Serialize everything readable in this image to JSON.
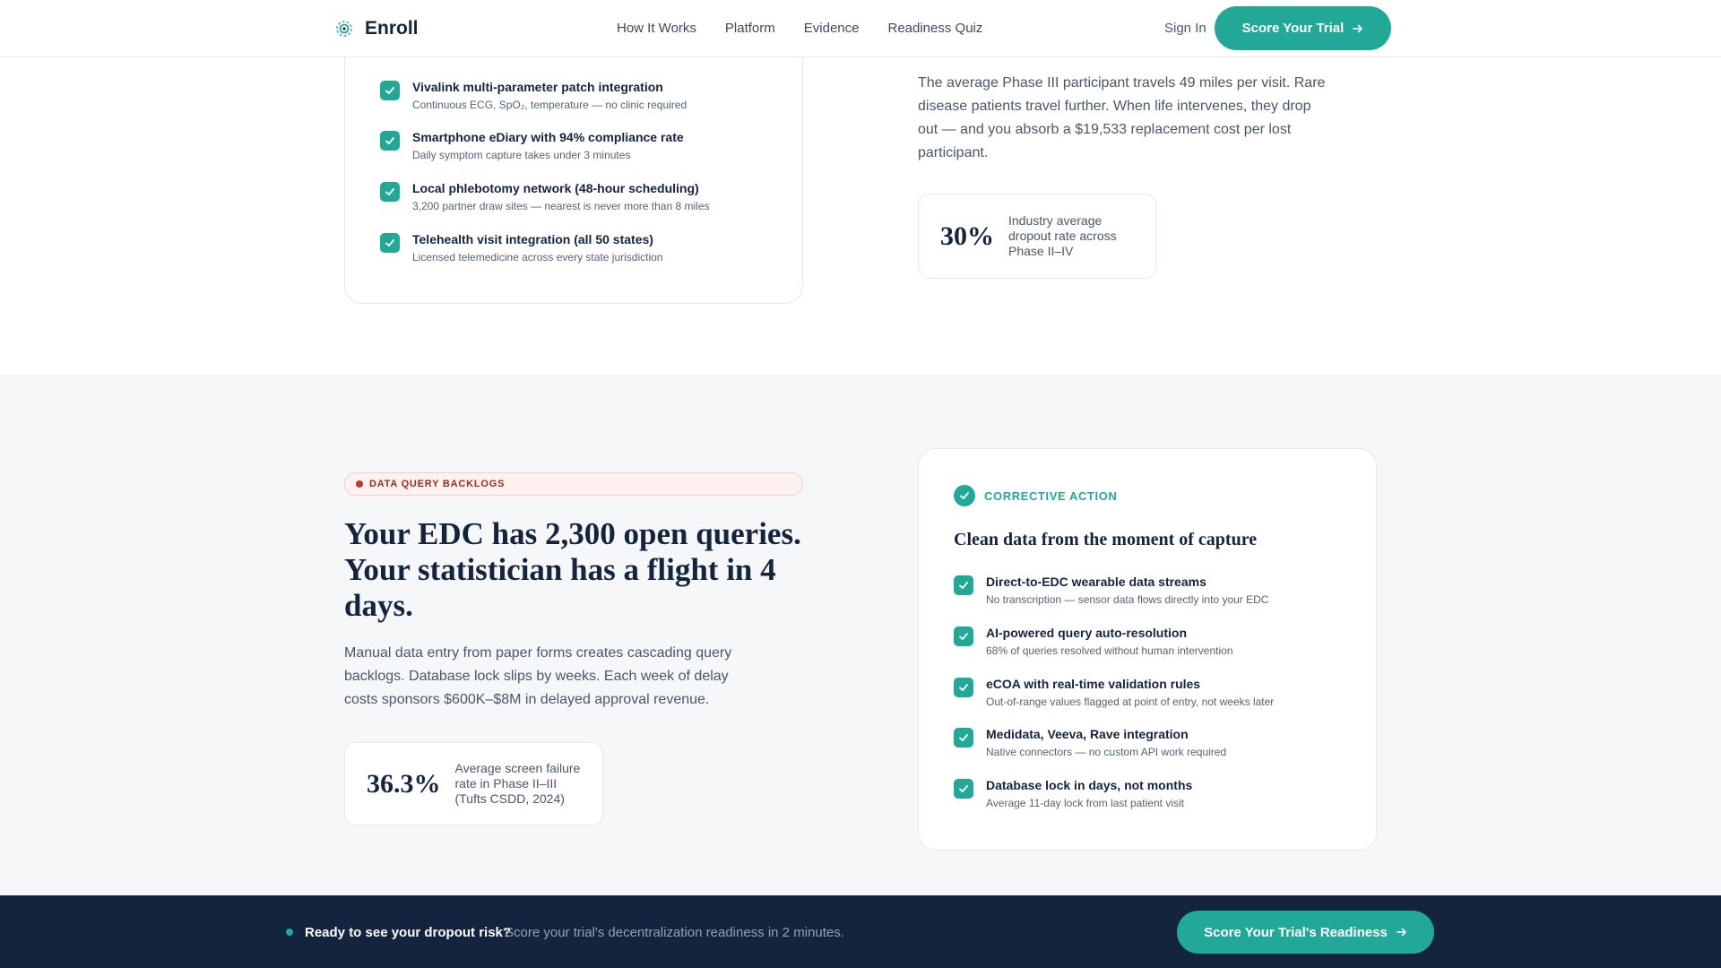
{
  "header": {
    "brand": "Enroll",
    "nav": [
      "How It Works",
      "Platform",
      "Evidence",
      "Readiness Quiz"
    ],
    "sign_in": "Sign In",
    "cta": "Score Your Trial"
  },
  "top_section": {
    "features": [
      {
        "title": "Vivalink multi-parameter patch integration",
        "sub": "Continuous ECG, SpO₂, temperature — no clinic required"
      },
      {
        "title": "Smartphone eDiary with 94% compliance rate",
        "sub": "Daily symptom capture takes under 3 minutes"
      },
      {
        "title": "Local phlebotomy network (48-hour scheduling)",
        "sub": "3,200 partner draw sites — nearest is never more than 8 miles"
      },
      {
        "title": "Telehealth visit integration (all 50 states)",
        "sub": "Licensed telemedicine across every state jurisdiction"
      }
    ],
    "paragraph": "The average Phase III participant travels 49 miles per visit. Rare disease patients travel further. When life intervenes, they drop out — and you absorb a $19,533 replacement cost per lost participant.",
    "stat": {
      "value": "30%",
      "desc": "Industry average dropout rate across Phase II–IV"
    }
  },
  "section2": {
    "badge": "DATA QUERY BACKLOGS",
    "heading": "Your EDC has 2,300 open queries. Your statistician has a flight in 4 days.",
    "paragraph": "Manual data entry from paper forms creates cascading query backlogs. Database lock slips by weeks. Each week of delay costs sponsors $600K–$8M in delayed approval revenue.",
    "stat": {
      "value": "36.3%",
      "desc": "Average screen failure rate in Phase II–III (Tufts CSDD, 2024)"
    },
    "corrective": {
      "label": "CORRECTIVE ACTION",
      "title": "Clean data from the moment of capture",
      "items": [
        {
          "title": "Direct-to-EDC wearable data streams",
          "sub": "No transcription — sensor data flows directly into your EDC"
        },
        {
          "title": "AI-powered query auto-resolution",
          "sub": "68% of queries resolved without human intervention"
        },
        {
          "title": "eCOA with real-time validation rules",
          "sub": "Out-of-range values flagged at point of entry, not weeks later"
        },
        {
          "title": "Medidata, Veeva, Rave integration",
          "sub": "Native connectors — no custom API work required"
        },
        {
          "title": "Database lock in days, not months",
          "sub": "Average 11-day lock from last patient visit"
        }
      ]
    }
  },
  "bottom_bar": {
    "bold": "Ready to see your dropout risk?",
    "light": "Score your trial's decentralization readiness in 2 minutes.",
    "cta": "Score Your Trial's Readiness"
  },
  "colors": {
    "accent": "#22a896",
    "navy": "#14243f",
    "alert": "#c0392b"
  }
}
